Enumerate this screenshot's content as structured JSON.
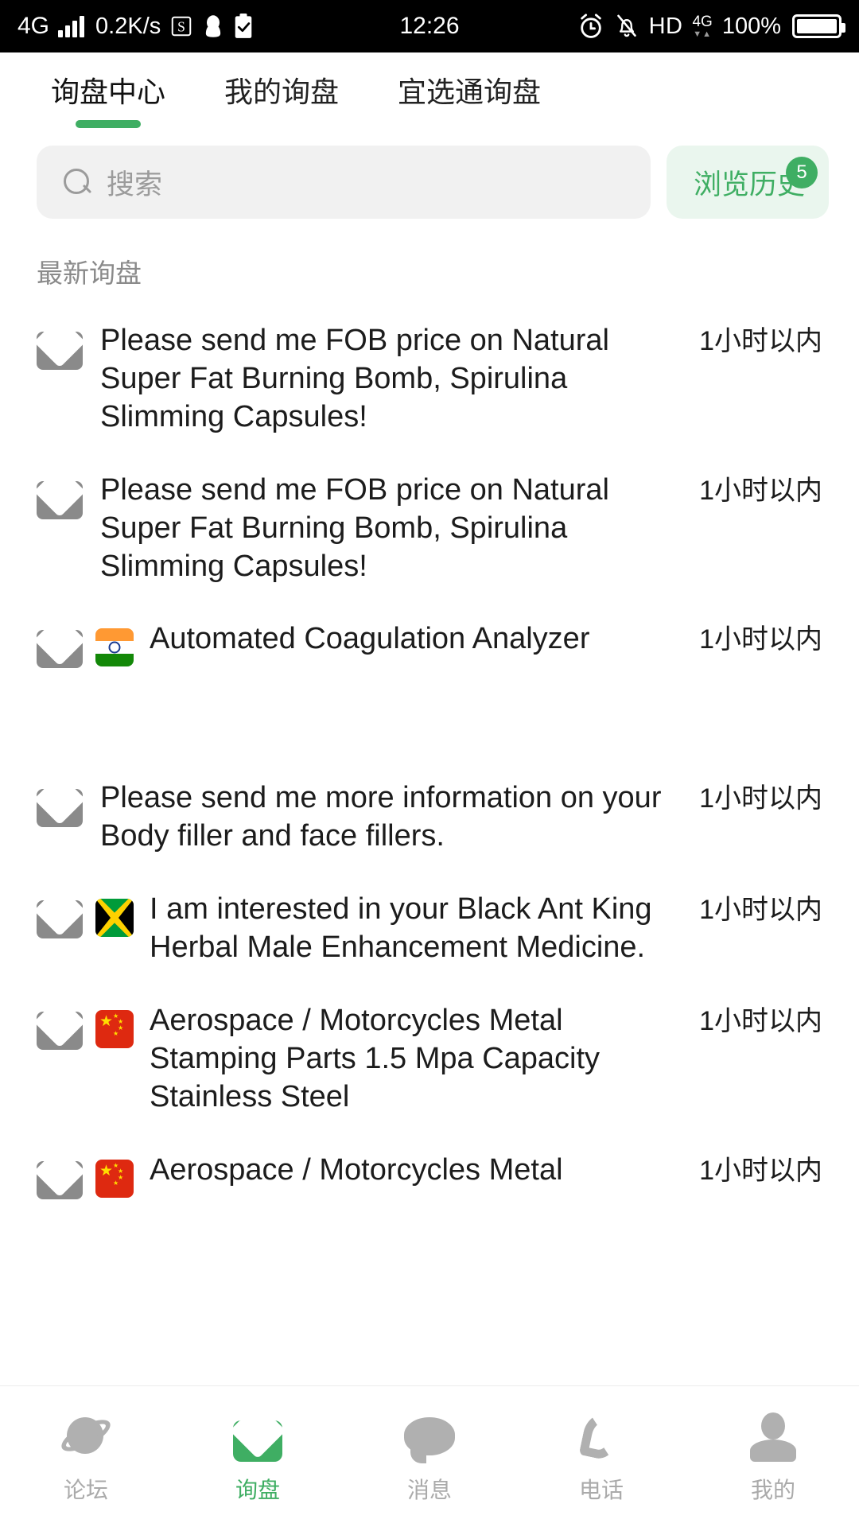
{
  "status_bar": {
    "network_type": "4G",
    "data_speed": "0.2K/s",
    "tray_icons": [
      "s-app-icon",
      "qq-penguin-icon",
      "clipboard-check-icon"
    ],
    "time": "12:26",
    "right_icons": [
      "alarm-clock-icon",
      "bell-off-icon"
    ],
    "hd_label": "HD",
    "secondary_network": "4G",
    "battery_percent": "100%"
  },
  "tabs": [
    {
      "label": "询盘中心",
      "active": true
    },
    {
      "label": "我的询盘",
      "active": false
    },
    {
      "label": "宜选通询盘",
      "active": false
    }
  ],
  "search": {
    "placeholder": "搜索",
    "icon": "search-icon"
  },
  "history_button": {
    "label": "浏览历史",
    "badge": "5"
  },
  "section": {
    "title": "最新询盘"
  },
  "inquiries": [
    {
      "icon": "envelope-icon",
      "flag": "none",
      "text": "Please send me FOB price on Natural Super Fat Burning Bomb, Spirulina Slimming Capsules!",
      "time": "1小时以内"
    },
    {
      "icon": "envelope-icon",
      "flag": "none",
      "text": "Please send me FOB price on Natural Super Fat Burning Bomb, Spirulina Slimming Capsules!",
      "time": "1小时以内"
    },
    {
      "icon": "envelope-icon",
      "flag": "india",
      "text": "Automated Coagulation Analyzer",
      "time": "1小时以内"
    },
    {
      "icon": "envelope-icon",
      "flag": "none",
      "text": "Please send me more information on your Body filler and face fillers.",
      "time": "1小时以内"
    },
    {
      "icon": "envelope-icon",
      "flag": "jamaica",
      "text": "I am interested in your Black Ant King Herbal Male Enhancement Medicine.",
      "time": "1小时以内"
    },
    {
      "icon": "envelope-icon",
      "flag": "china",
      "text": "Aerospace / Motorcycles Metal Stamping Parts 1.5 Mpa Capacity Stainless Steel",
      "time": "1小时以内"
    },
    {
      "icon": "envelope-icon",
      "flag": "china",
      "text": "Aerospace / Motorcycles Metal",
      "time": "1小时以内"
    }
  ],
  "bottom_nav": [
    {
      "label": "论坛",
      "icon": "planet-icon",
      "active": false
    },
    {
      "label": "询盘",
      "icon": "envelope-icon",
      "active": true
    },
    {
      "label": "消息",
      "icon": "chat-bubble-icon",
      "active": false
    },
    {
      "label": "电话",
      "icon": "phone-icon",
      "active": false
    },
    {
      "label": "我的",
      "icon": "person-icon",
      "active": false
    }
  ],
  "colors": {
    "accent": "#3fae63",
    "accent_bg": "#eaf6ee",
    "search_bg": "#f1f1f1",
    "muted_text": "#8a8a8a",
    "icon_gray": "#8a8a8a"
  }
}
